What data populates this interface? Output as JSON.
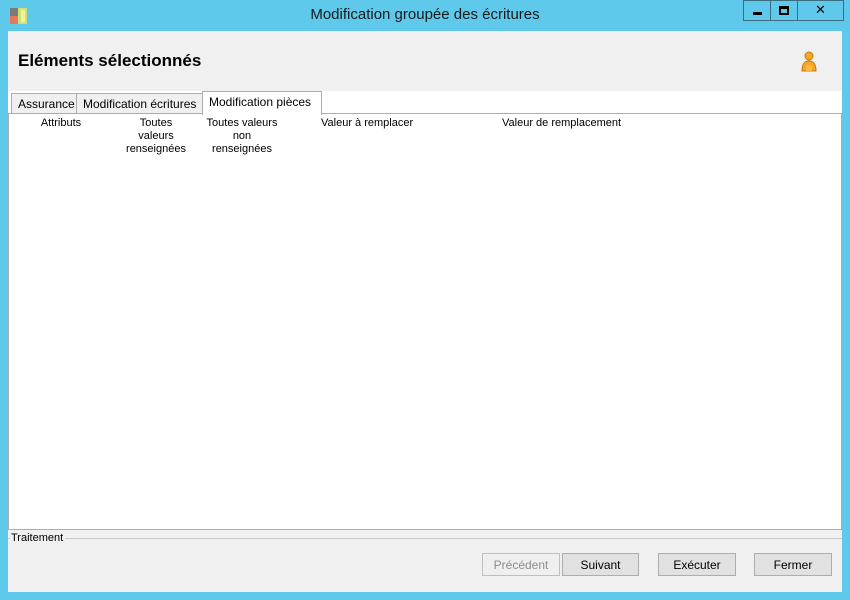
{
  "window": {
    "title": "Modification groupée des écritures",
    "accent_color": "#5ec9ea",
    "buttons": {
      "minimize": "minimize-icon",
      "maximize": "maximize-icon",
      "close": "close-icon"
    }
  },
  "header": {
    "title": "Eléments sélectionnés",
    "user_icon": "user-icon"
  },
  "tabs": [
    {
      "label": "Assurance",
      "active": false
    },
    {
      "label": "Modification écritures",
      "active": false
    },
    {
      "label": "Modification pièces",
      "active": true
    }
  ],
  "panel": {
    "columns": [
      "Attributs",
      "Toutes valeurs renseignées",
      "Toutes valeurs non renseignées",
      "Valeur à remplacer",
      "Valeur de remplacement"
    ]
  },
  "footer": {
    "group_label": "Traitement",
    "buttons": {
      "previous": "Précédent",
      "next": "Suivant",
      "execute": "Exécuter",
      "close": "Fermer"
    }
  }
}
